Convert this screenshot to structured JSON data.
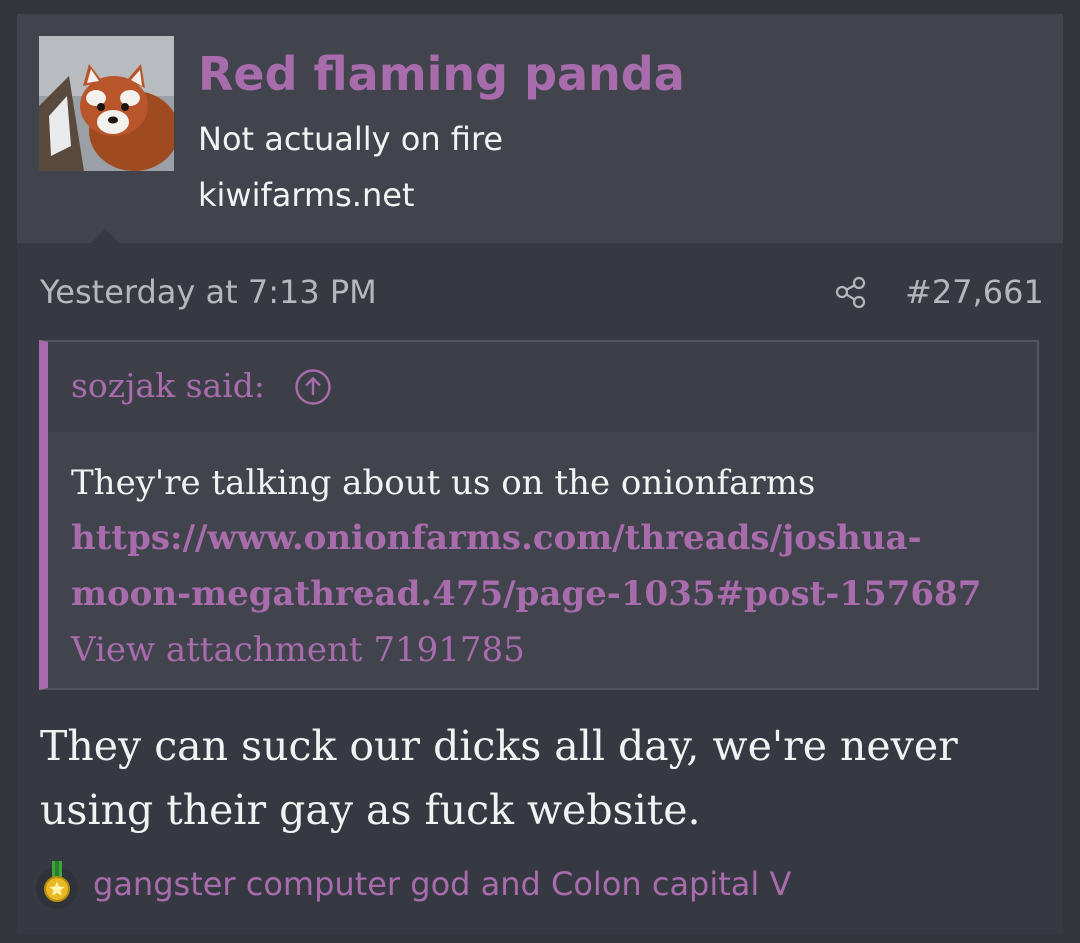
{
  "user": {
    "username": "Red flaming panda",
    "title": "Not actually on fire",
    "site": "kiwifarms.net",
    "avatar_icon": "red-panda-avatar"
  },
  "post": {
    "date": "Yesterday at 7:13 PM",
    "number": "#27,661",
    "share_icon": "share-icon"
  },
  "quote": {
    "author": "sozjak said:",
    "jump_icon": "arrow-up-circle-icon",
    "text": "They're talking about us on the onionfarms",
    "link_line1": "https://www.onionfarms.com/threads/joshua-",
    "link_line2": "moon-megathread.475/page-1035#post-157687",
    "attachment": "View attachment 7191785"
  },
  "body": {
    "line1": "They can suck our dicks all day, we're never",
    "line2": "using their gay as fuck website."
  },
  "badge": {
    "icon": "medal-icon",
    "text": "gangster computer god and Colon capital V"
  },
  "colors": {
    "accent": "#a86cad",
    "background": "#363941",
    "header": "#41444c",
    "text": "#f2f2f2",
    "muted": "#b5b7bc"
  }
}
